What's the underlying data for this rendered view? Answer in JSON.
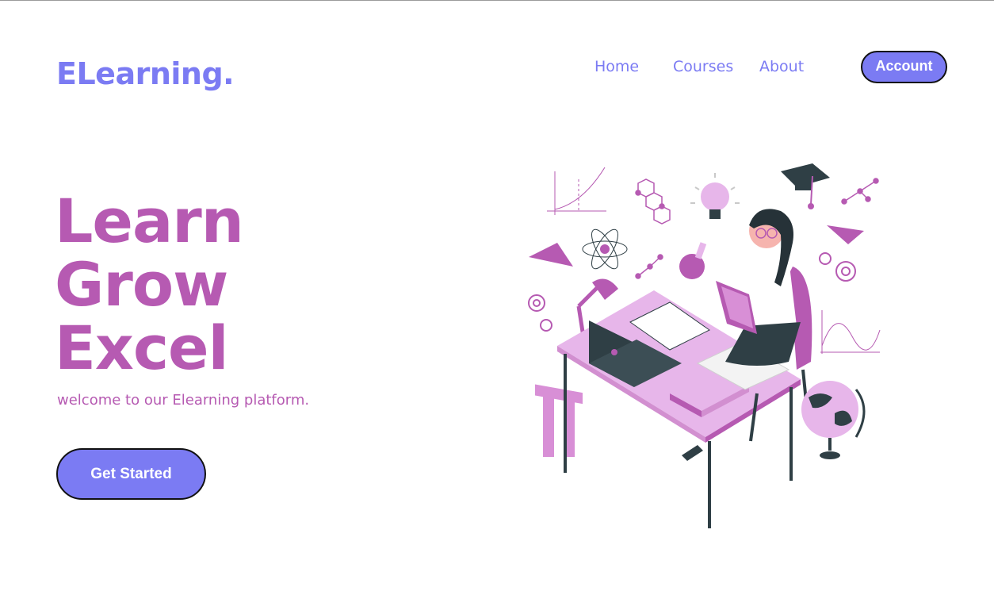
{
  "header": {
    "logo": "ELearning.",
    "nav": [
      {
        "label": "Home"
      },
      {
        "label": "Courses"
      },
      {
        "label": "About"
      }
    ],
    "account_label": "Account"
  },
  "hero": {
    "title_lines": [
      "Learn",
      "Grow",
      "Excel"
    ],
    "tagline": "welcome to our Elearning platform.",
    "cta_label": "Get Started",
    "illustration": "student-studying-at-desk-illustration"
  },
  "colors": {
    "brand": "#7b7bf3",
    "accent": "#b65ab2",
    "illustration_pink": "#e7b6ea",
    "illustration_dark": "#2f3f45"
  }
}
